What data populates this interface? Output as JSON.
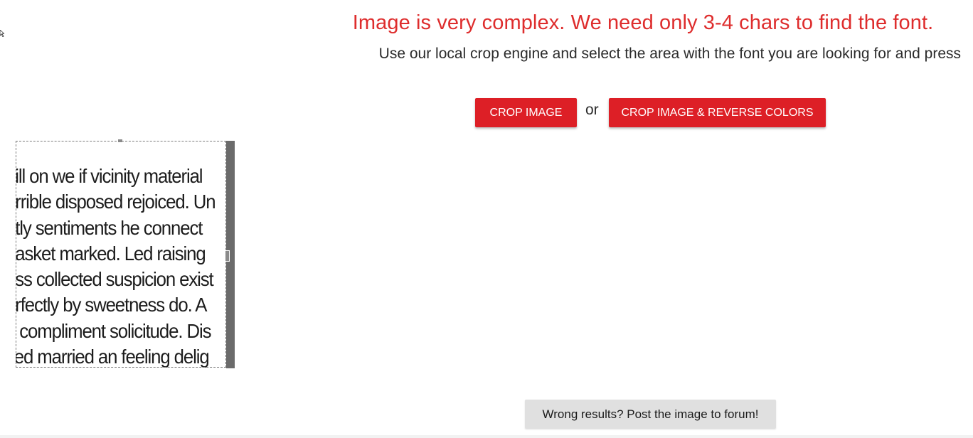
{
  "header": {
    "headline": "Image is very complex. We need only 3-4 chars to find the font.",
    "instructions": "Use our local crop engine and select the area with the font you are looking for and press"
  },
  "actions": {
    "crop_label": "CROP IMAGE",
    "or_label": "or",
    "crop_reverse_label": "CROP IMAGE & REVERSE COLORS"
  },
  "crop_preview": {
    "lines": [
      "hill on we if vicinity material",
      "orrible disposed rejoiced. Un",
      "ntly sentiments he connect",
      "basket marked. Led raising",
      "ess collected suspicion exist",
      "erfectly by sweetness do. A",
      "d compliment solicitude. Dis",
      "yed married an feeling delig"
    ]
  },
  "footer": {
    "forum_label": "Wrong results? Post the image to forum!"
  },
  "colors": {
    "accent": "#dd1f26",
    "headline": "#de2d2d",
    "forum_button": "#e0e0e0"
  },
  "icons": {
    "cursor": "cursor-icon"
  }
}
